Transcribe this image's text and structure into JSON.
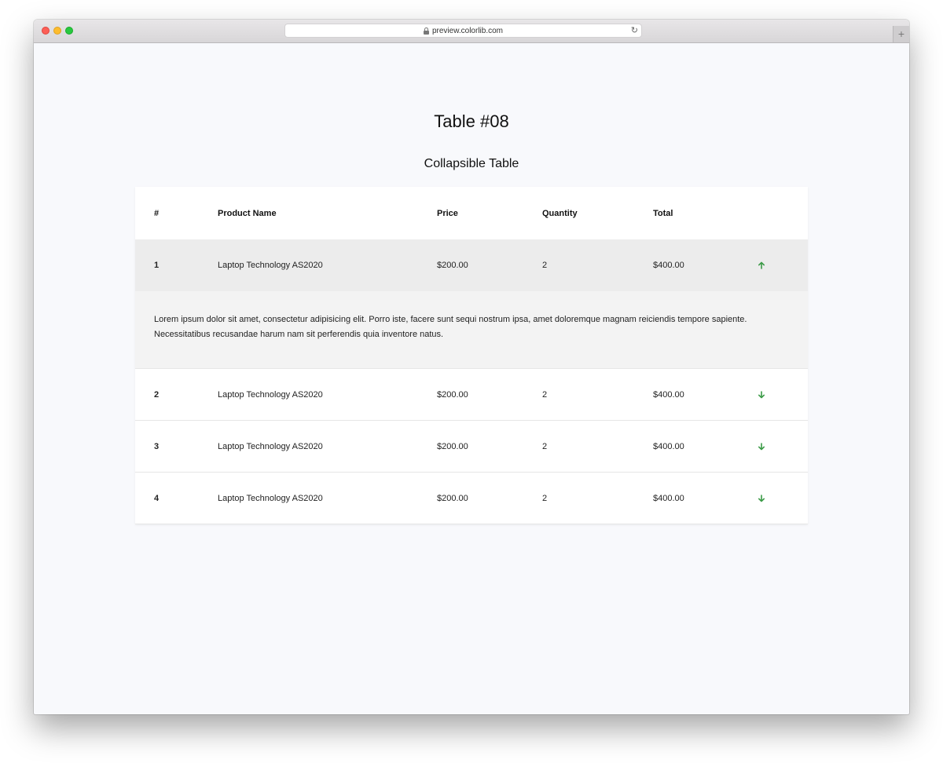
{
  "browser": {
    "url": "preview.colorlib.com"
  },
  "page": {
    "title": "Table #08",
    "subtitle": "Collapsible Table"
  },
  "table": {
    "headers": [
      "#",
      "Product Name",
      "Price",
      "Quantity",
      "Total"
    ],
    "rows": [
      {
        "num": "1",
        "name": "Laptop Technology AS2020",
        "price": "$200.00",
        "qty": "2",
        "total": "$400.00",
        "expanded": true
      },
      {
        "num": "2",
        "name": "Laptop Technology AS2020",
        "price": "$200.00",
        "qty": "2",
        "total": "$400.00",
        "expanded": false
      },
      {
        "num": "3",
        "name": "Laptop Technology AS2020",
        "price": "$200.00",
        "qty": "2",
        "total": "$400.00",
        "expanded": false
      },
      {
        "num": "4",
        "name": "Laptop Technology AS2020",
        "price": "$200.00",
        "qty": "2",
        "total": "$400.00",
        "expanded": false
      }
    ],
    "details_text": "Lorem ipsum dolor sit amet, consectetur adipisicing elit. Porro iste, facere sunt sequi nostrum ipsa, amet doloremque magnam reiciendis tempore sapiente. Necessitatibus recusandae harum nam sit perferendis quia inventore natus.",
    "toggle_color": "#3a9a46"
  },
  "icons": {
    "lock": "lock-icon",
    "reload": "reload-icon",
    "collapse": "arrow-up-icon",
    "expand": "arrow-down-icon"
  }
}
